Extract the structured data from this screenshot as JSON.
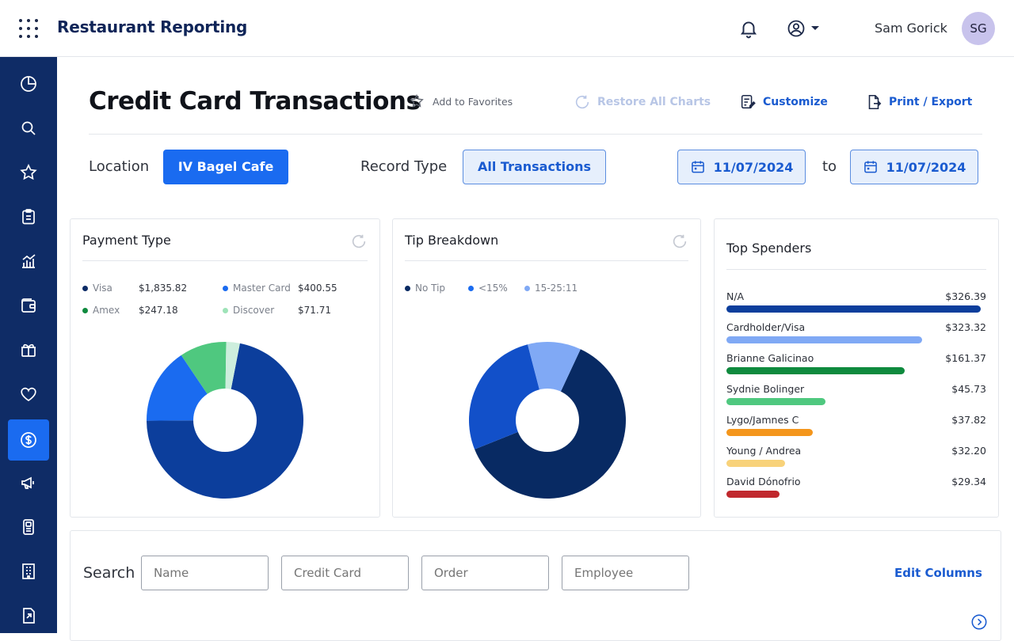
{
  "header": {
    "app_title": "Restaurant Reporting",
    "user_name": "Sam Gorick",
    "avatar_initials": "SG"
  },
  "sidebar": {
    "items": [
      {
        "icon": "pie-chart-icon"
      },
      {
        "icon": "search-icon"
      },
      {
        "icon": "star-icon"
      },
      {
        "icon": "clipboard-icon"
      },
      {
        "icon": "bar-chart-icon"
      },
      {
        "icon": "wallet-icon"
      },
      {
        "icon": "gift-icon"
      },
      {
        "icon": "heart-icon"
      },
      {
        "icon": "dollar-icon",
        "active": true
      },
      {
        "icon": "megaphone-icon"
      },
      {
        "icon": "terminal-icon"
      },
      {
        "icon": "building-icon"
      },
      {
        "icon": "export-file-icon"
      }
    ]
  },
  "page": {
    "title": "Credit Card Transactions",
    "add_favorites": "Add to Favorites",
    "restore_charts": "Restore All Charts",
    "customize": "Customize",
    "print_export": "Print / Export"
  },
  "filters": {
    "location_label": "Location",
    "location_value": "IV Bagel Cafe",
    "record_type_label": "Record Type",
    "record_type_value": "All Transactions",
    "date_from": "11/07/2024",
    "to_label": "to",
    "date_to": "11/07/2024"
  },
  "colors": {
    "primary": "#1a6bf0",
    "sidebar": "#0f2c66",
    "link": "#1a5bd0"
  },
  "chart_data": [
    {
      "type": "pie",
      "title": "Payment Type",
      "legend": [
        {
          "label": "Visa",
          "value_label": "$1,835.82",
          "value": 1835.82,
          "color": "#0c3e9c"
        },
        {
          "label": "Master Card",
          "value_label": "$400.55",
          "value": 400.55,
          "color": "#1a6bf0"
        },
        {
          "label": "Amex",
          "value_label": "$247.18",
          "value": 247.18,
          "color": "#4fc87f"
        },
        {
          "label": "Discover",
          "value_label": "$71.71",
          "value": 71.71,
          "color": "#cdeedd"
        }
      ]
    },
    {
      "type": "pie",
      "title": "Tip Breakdown",
      "legend": [
        {
          "label": "No Tip",
          "value": 62,
          "color": "#082a63"
        },
        {
          "label": "<15%",
          "value": 27,
          "color": "#1250c9"
        },
        {
          "label": "15-25:11",
          "value": 11,
          "color": "#80a9f5"
        }
      ]
    },
    {
      "type": "bar",
      "title": "Top Spenders",
      "categories": [
        "N/A",
        "Cardholder/Visa",
        "Brianne Galicinao",
        "Sydnie Bolinger",
        "Lygo/Jamnes C",
        "Young / Andrea",
        "David Dónofrio"
      ],
      "value_labels": [
        "$326.39",
        "$323.32",
        "$161.37",
        "$45.73",
        "$37.82",
        "$32.20",
        "$29.34"
      ],
      "bar_fraction": [
        1.0,
        0.77,
        0.7,
        0.39,
        0.34,
        0.23,
        0.21
      ],
      "colors": [
        "#0c3e9c",
        "#80a9f5",
        "#0f8a3e",
        "#4fc87f",
        "#f4961c",
        "#f8d27a",
        "#c0282d"
      ]
    }
  ],
  "search": {
    "label": "Search",
    "fields": [
      {
        "placeholder": "Name"
      },
      {
        "placeholder": "Credit Card"
      },
      {
        "placeholder": "Order"
      },
      {
        "placeholder": "Employee"
      }
    ],
    "edit_columns": "Edit Columns"
  }
}
